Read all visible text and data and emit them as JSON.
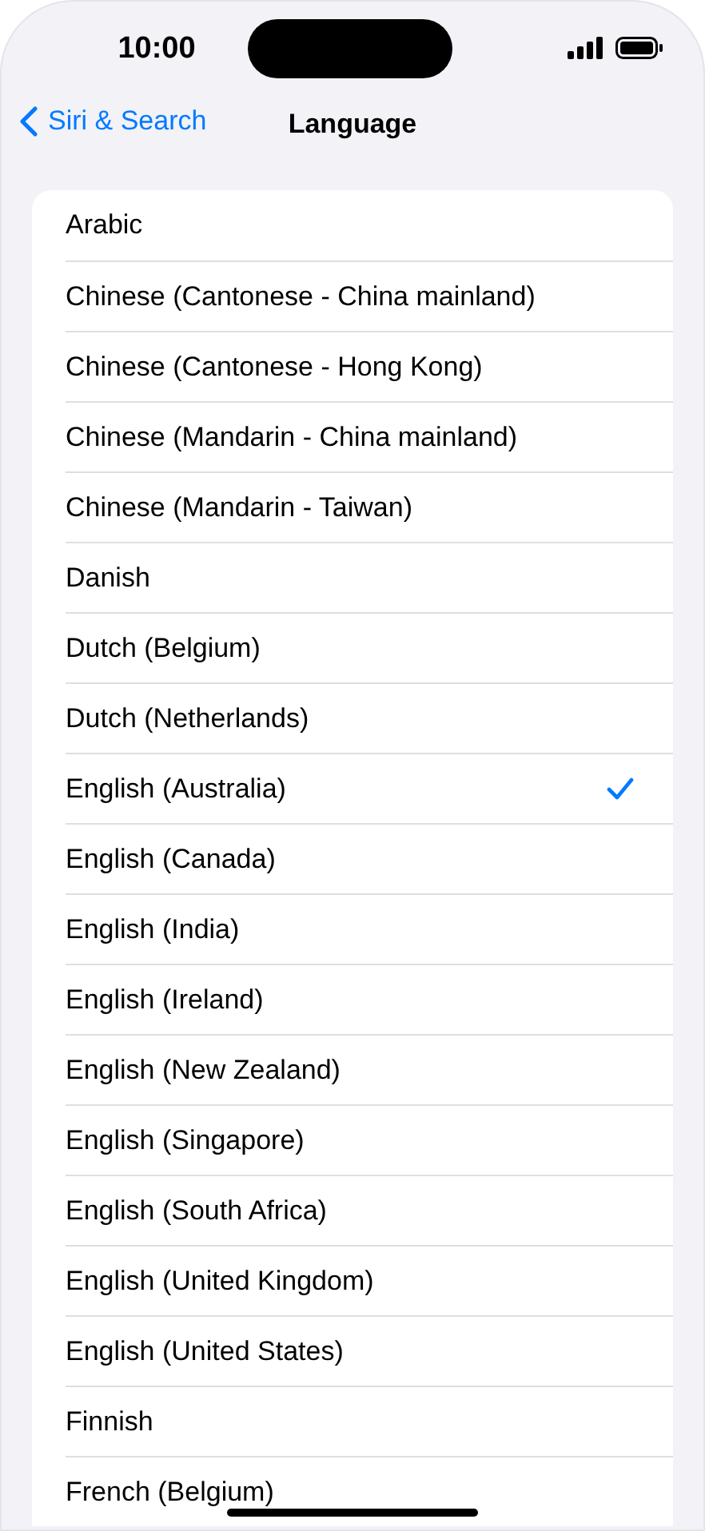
{
  "status_bar": {
    "time": "10:00"
  },
  "nav": {
    "back_label": "Siri & Search",
    "title": "Language"
  },
  "languages": [
    {
      "label": "Arabic",
      "selected": false
    },
    {
      "label": "Chinese (Cantonese - China mainland)",
      "selected": false
    },
    {
      "label": "Chinese (Cantonese - Hong Kong)",
      "selected": false
    },
    {
      "label": "Chinese (Mandarin - China mainland)",
      "selected": false
    },
    {
      "label": "Chinese (Mandarin - Taiwan)",
      "selected": false
    },
    {
      "label": "Danish",
      "selected": false
    },
    {
      "label": "Dutch (Belgium)",
      "selected": false
    },
    {
      "label": "Dutch (Netherlands)",
      "selected": false
    },
    {
      "label": "English (Australia)",
      "selected": true
    },
    {
      "label": "English (Canada)",
      "selected": false
    },
    {
      "label": "English (India)",
      "selected": false
    },
    {
      "label": "English (Ireland)",
      "selected": false
    },
    {
      "label": "English (New Zealand)",
      "selected": false
    },
    {
      "label": "English (Singapore)",
      "selected": false
    },
    {
      "label": "English (South Africa)",
      "selected": false
    },
    {
      "label": "English (United Kingdom)",
      "selected": false
    },
    {
      "label": "English (United States)",
      "selected": false
    },
    {
      "label": "Finnish",
      "selected": false
    },
    {
      "label": "French (Belgium)",
      "selected": false
    }
  ]
}
